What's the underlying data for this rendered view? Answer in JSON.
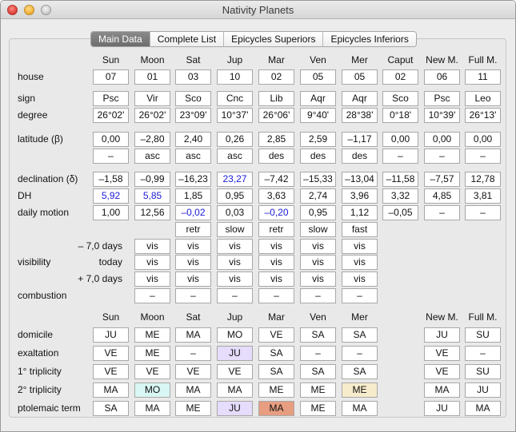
{
  "window": {
    "title": "Nativity Planets"
  },
  "tabs": [
    "Main Data",
    "Complete List",
    "Epicycles Superiors",
    "Epicycles Inferiors"
  ],
  "active_tab": 0,
  "columns": [
    "Sun",
    "Moon",
    "Sat",
    "Jup",
    "Mar",
    "Ven",
    "Mer",
    "Caput",
    "New M.",
    "Full M."
  ],
  "labels": {
    "house": "house",
    "sign": "sign",
    "degree": "degree",
    "latitude": "latitude (β)",
    "declination": "declination (δ)",
    "dh": "DH",
    "daily_motion": "daily motion",
    "visibility": "visibility",
    "vis_minus": "– 7,0 days",
    "vis_today": "today",
    "vis_plus": "+ 7,0 days",
    "combustion": "combustion",
    "domicile": "domicile",
    "exaltation": "exaltation",
    "triplicity1": "1° triplicity",
    "triplicity2": "2° triplicity",
    "ptolemaic": "ptolemaic term"
  },
  "rows": {
    "house": [
      "07",
      "01",
      "03",
      "10",
      "02",
      "05",
      "05",
      "02",
      "06",
      "11"
    ],
    "sign": [
      "Psc",
      "Vir",
      "Sco",
      "Cnc",
      "Lib",
      "Aqr",
      "Aqr",
      "Sco",
      "Psc",
      "Leo"
    ],
    "degree": [
      "26°02'",
      "26°02'",
      "23°09'",
      "10°37'",
      "26°06'",
      "9°40'",
      "28°38'",
      "0°18'",
      "10°39'",
      "26°13'"
    ],
    "latitude": [
      "0,00",
      "–2,80",
      "2,40",
      "0,26",
      "2,85",
      "2,59",
      "–1,17",
      "0,00",
      "0,00",
      "0,00"
    ],
    "latitude_dir": [
      "–",
      "asc",
      "asc",
      "asc",
      "des",
      "des",
      "des",
      "–",
      "–",
      "–"
    ],
    "declination": [
      "–1,58",
      "–0,99",
      "–16,23",
      "23,27",
      "–7,42",
      "–15,33",
      "–13,04",
      "–11,58",
      "–7,57",
      "12,78"
    ],
    "declination_colors": [
      "",
      "",
      "",
      "#1a1ad6",
      "",
      "",
      "",
      "",
      "",
      ""
    ],
    "dh": [
      "5,92",
      "5,85",
      "1,85",
      "0,95",
      "3,63",
      "2,74",
      "3,96",
      "3,32",
      "4,85",
      "3,81"
    ],
    "dh_colors": [
      "#1a1ad6",
      "#1a1ad6",
      "",
      "",
      "",
      "",
      "",
      "",
      "",
      ""
    ],
    "daily_motion": [
      "1,00",
      "12,56",
      "–0,02",
      "0,03",
      "–0,20",
      "0,95",
      "1,12",
      "–0,05",
      "–",
      "–"
    ],
    "daily_motion_colors": [
      "",
      "",
      "#1a1ad6",
      "",
      "#1a1ad6",
      "",
      "",
      "",
      "",
      ""
    ],
    "motion_state": [
      "retr",
      "slow",
      "retr",
      "slow",
      "fast"
    ],
    "vis_minus": [
      "vis",
      "vis",
      "vis",
      "vis",
      "vis",
      "vis"
    ],
    "vis_today": [
      "vis",
      "vis",
      "vis",
      "vis",
      "vis",
      "vis"
    ],
    "vis_plus": [
      "vis",
      "vis",
      "vis",
      "vis",
      "vis",
      "vis"
    ],
    "combustion": [
      "–",
      "–",
      "–",
      "–",
      "–",
      "–"
    ]
  },
  "dignity_columns": [
    "Sun",
    "Moon",
    "Sat",
    "Jup",
    "Mar",
    "Ven",
    "Mer",
    "New M.",
    "Full M."
  ],
  "dignities": {
    "domicile": [
      "JU",
      "ME",
      "MA",
      "MO",
      "VE",
      "SA",
      "SA",
      "JU",
      "SU"
    ],
    "domicile_bg": [
      "",
      "",
      "",
      "",
      "",
      "",
      "",
      "",
      ""
    ],
    "exaltation": [
      "VE",
      "ME",
      "–",
      "JU",
      "SA",
      "–",
      "–",
      "VE",
      "–"
    ],
    "exaltation_bg": [
      "",
      "",
      "",
      "#e6dcfb",
      "",
      "",
      "",
      "",
      ""
    ],
    "triplicity1": [
      "VE",
      "VE",
      "VE",
      "VE",
      "SA",
      "SA",
      "SA",
      "VE",
      "SU"
    ],
    "triplicity1_bg": [
      "",
      "",
      "",
      "",
      "",
      "",
      "",
      "",
      ""
    ],
    "triplicity2": [
      "MA",
      "MO",
      "MA",
      "MA",
      "ME",
      "ME",
      "ME",
      "MA",
      "JU"
    ],
    "triplicity2_bg": [
      "",
      "#d9f7f4",
      "",
      "",
      "",
      "",
      "#f7eccb",
      "",
      ""
    ],
    "ptolemaic": [
      "SA",
      "MA",
      "ME",
      "JU",
      "MA",
      "ME",
      "MA",
      "JU",
      "MA"
    ],
    "ptolemaic_bg": [
      "",
      "",
      "",
      "#e6dcfb",
      "#e79e80",
      "",
      "",
      "",
      ""
    ]
  }
}
